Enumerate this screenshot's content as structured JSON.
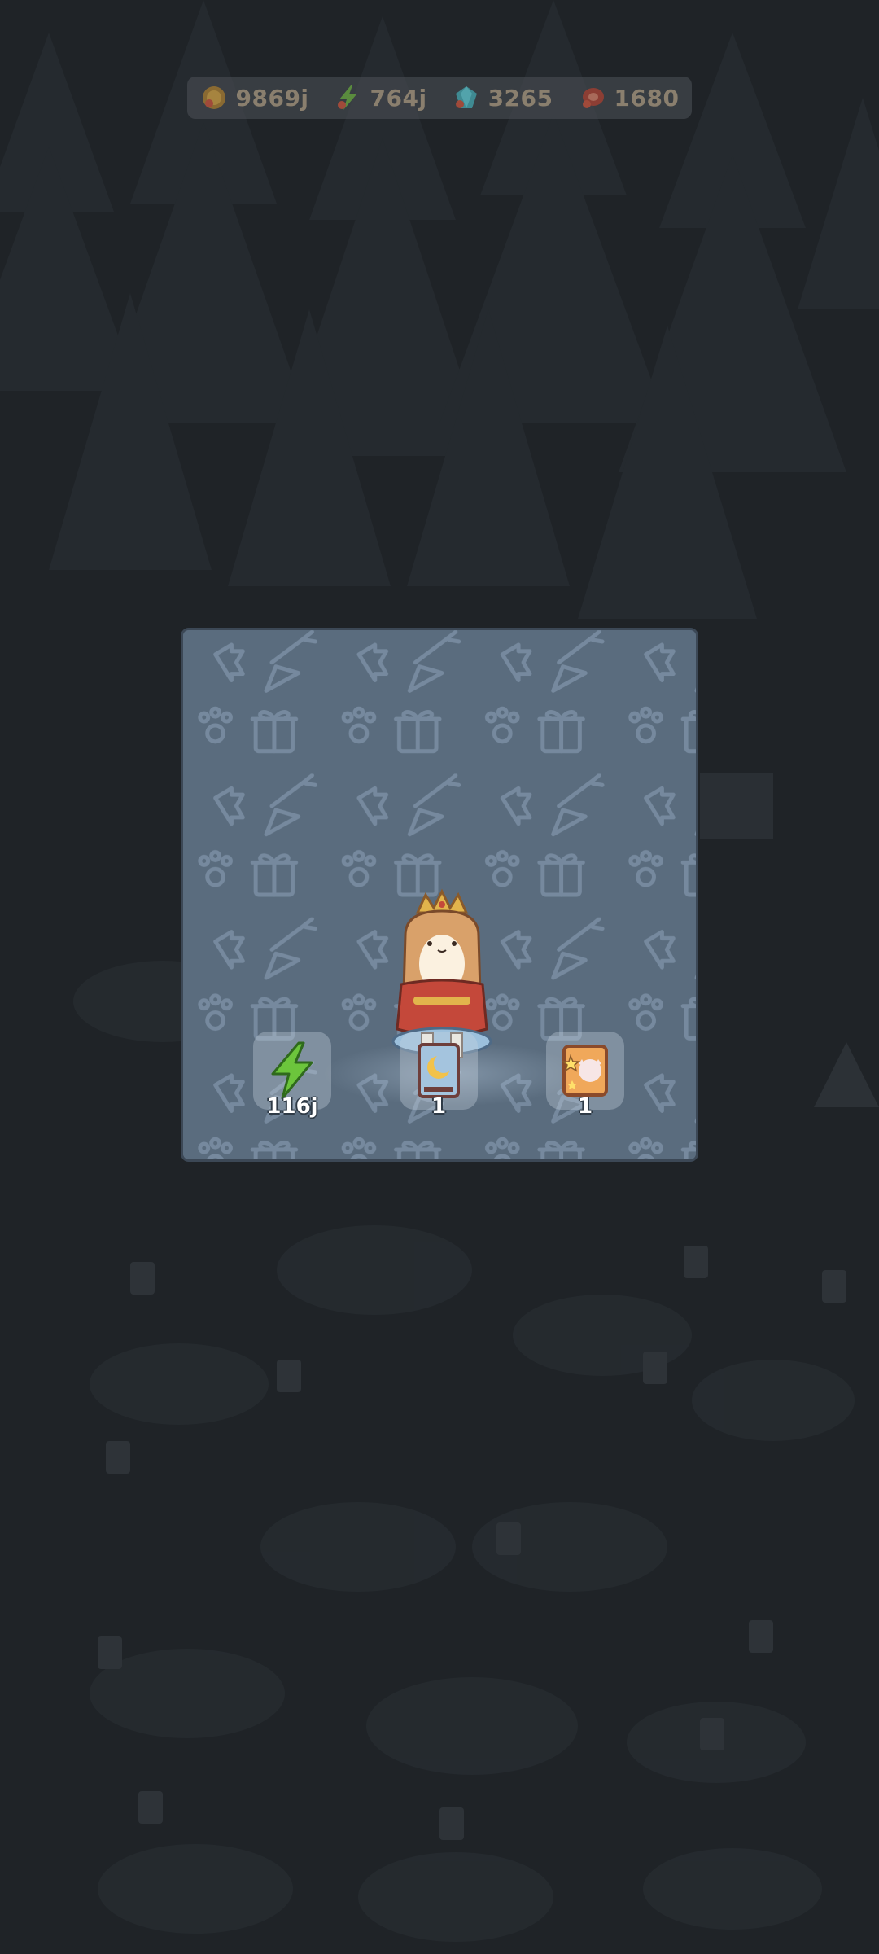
{
  "resources": {
    "coins": {
      "value": "9869j",
      "icon": "coin-icon"
    },
    "energy": {
      "value": "764j",
      "icon": "lightning-icon"
    },
    "gems": {
      "value": "3265",
      "icon": "gem-icon"
    },
    "meat": {
      "value": "1680",
      "icon": "meat-icon"
    }
  },
  "reward": {
    "items": [
      {
        "icon": "lightning-icon",
        "count": "116j"
      },
      {
        "icon": "moon-card-icon",
        "count": "1"
      },
      {
        "icon": "star-cat-card-icon",
        "count": "1"
      }
    ]
  },
  "colors": {
    "panel": "#5a6c7e",
    "overlay": "#1e2226",
    "count_text": "#ffffff"
  }
}
